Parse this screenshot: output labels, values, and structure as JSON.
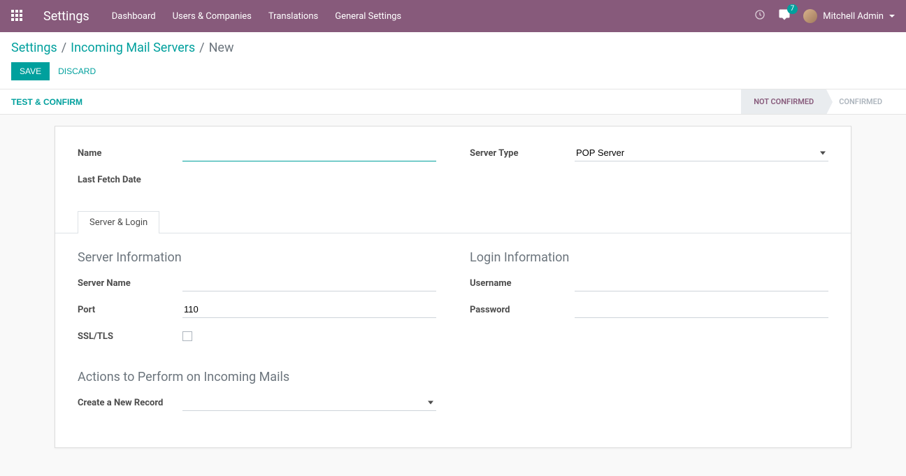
{
  "navbar": {
    "brand": "Settings",
    "menu": [
      "Dashboard",
      "Users & Companies",
      "Translations",
      "General Settings"
    ],
    "message_count": "7",
    "user_name": "Mitchell Admin"
  },
  "breadcrumb": {
    "root": "Settings",
    "parent": "Incoming Mail Servers",
    "current": "New"
  },
  "buttons": {
    "save": "SAVE",
    "discard": "DISCARD",
    "test_confirm": "TEST & CONFIRM"
  },
  "status": {
    "not_confirmed": "NOT CONFIRMED",
    "confirmed": "CONFIRMED"
  },
  "form": {
    "labels": {
      "name": "Name",
      "server_type": "Server Type",
      "last_fetch_date": "Last Fetch Date",
      "server_name": "Server Name",
      "port": "Port",
      "ssl_tls": "SSL/TLS",
      "username": "Username",
      "password": "Password",
      "create_record": "Create a New Record"
    },
    "values": {
      "name": "",
      "server_type": "POP Server",
      "last_fetch_date": "",
      "server_name": "",
      "port": "110",
      "username": "",
      "password": "",
      "create_record": ""
    },
    "tabs": {
      "server_login": "Server & Login"
    },
    "sections": {
      "server_info": "Server Information",
      "login_info": "Login Information",
      "actions": "Actions to Perform on Incoming Mails"
    }
  }
}
